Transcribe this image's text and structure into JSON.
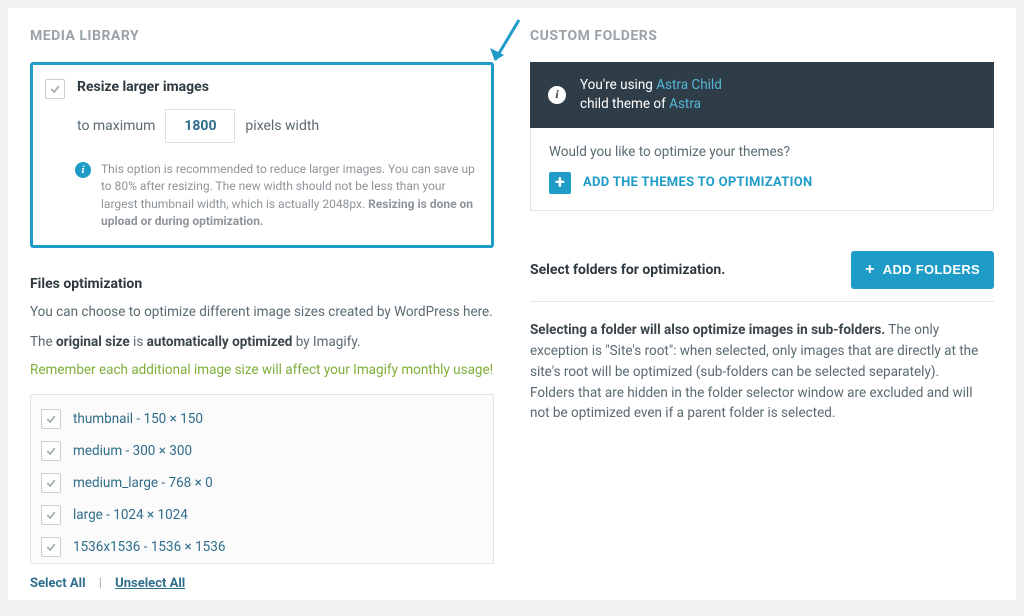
{
  "media_library": {
    "title": "MEDIA LIBRARY",
    "resize": {
      "label": "Resize larger images",
      "prefix": "to maximum",
      "value": "1800",
      "suffix": "pixels width",
      "info_prefix": "This option is recommended to reduce larger images. You can save up to 80% after resizing. The new width should not be less than your largest thumbnail width, which is actually 2048px. ",
      "info_bold": "Resizing is done on upload or during optimization."
    },
    "files_opt": {
      "heading": "Files optimization",
      "desc": "You can choose to optimize different image sizes created by WordPress here.",
      "line2_a": "The ",
      "line2_b": "original size",
      "line2_c": " is ",
      "line2_d": "automatically optimized",
      "line2_e": " by Imagify.",
      "green": "Remember each additional image size will affect your Imagify monthly usage!",
      "sizes": [
        "thumbnail - 150 × 150",
        "medium - 300 × 300",
        "medium_large - 768 × 0",
        "large - 1024 × 1024",
        "1536x1536 - 1536 × 1536"
      ],
      "select_all": "Select All",
      "unselect_all": "Unselect All"
    }
  },
  "custom_folders": {
    "title": "CUSTOM FOLDERS",
    "theme_info_prefix": "You're using ",
    "theme_child": "Astra Child",
    "theme_info_mid": "child theme of ",
    "theme_parent": "Astra",
    "optimize_prompt": "Would you like to optimize your themes?",
    "add_themes": "ADD THE THEMES TO OPTIMIZATION",
    "select_folders_label": "Select folders for optimization.",
    "add_folders": "ADD FOLDERS",
    "desc_bold": "Selecting a folder will also optimize images in sub-folders.",
    "desc_rest": " The only exception is \"Site's root\": when selected, only images that are directly at the site's root will be optimized (sub-folders can be selected separately).",
    "desc_line2": "Folders that are hidden in the folder selector window are excluded and will not be optimized even if a parent folder is selected."
  }
}
